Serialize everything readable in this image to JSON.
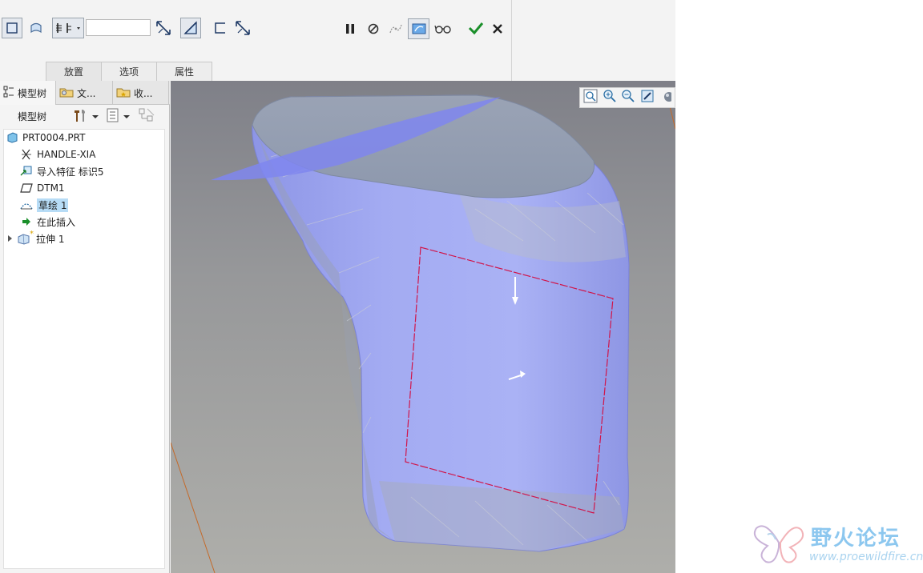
{
  "dashboard": {
    "depth_value": "",
    "tabs": [
      {
        "label": "放置"
      },
      {
        "label": "选项"
      },
      {
        "label": "属性"
      }
    ],
    "icons": {
      "solid": "solid-extrude-icon",
      "surface": "surface-extrude-icon",
      "depth_options": "depth-options-icon",
      "flip_depth": "flip-depth-icon",
      "remove_material": "remove-material-icon",
      "thicken": "thicken-sketch-icon",
      "flip_thicken": "flip-thicken-icon",
      "pause": "pause-icon",
      "no_preview": "no-preview-icon",
      "verify": "verify-icon",
      "preview": "preview-icon",
      "glasses": "glasses-icon",
      "ok": "checkmark-icon",
      "cancel": "close-icon"
    },
    "colors": {
      "ok": "#1a8f2a",
      "cancel": "#222222"
    }
  },
  "left_panel": {
    "tabs": [
      {
        "label": "模型树"
      },
      {
        "label": "文..."
      },
      {
        "label": "收..."
      }
    ],
    "toolbar_label": "模型树",
    "tree": [
      {
        "label": "PRT0004.PRT",
        "icon": "part-icon"
      },
      {
        "label": "HANDLE-XIA",
        "icon": "csys-icon"
      },
      {
        "label": "导入特征 标识5",
        "icon": "import-feature-icon"
      },
      {
        "label": "DTM1",
        "icon": "datum-plane-icon"
      },
      {
        "label": "草绘 1",
        "icon": "sketch-icon",
        "selected": true
      },
      {
        "label": "在此插入",
        "icon": "insert-here-icon"
      },
      {
        "label": "拉伸 1",
        "icon": "extrude-icon",
        "expandable": true
      }
    ]
  },
  "viewport": {
    "toolbar_icons": [
      "refit-icon",
      "zoom-in-icon",
      "zoom-out-icon",
      "repaint-icon",
      "display-style-icon"
    ],
    "colors": {
      "model": "#9aa2ee",
      "sketch": "#d0154a",
      "datum_plane": "#7f86ee"
    }
  },
  "watermark": {
    "title": "野火论坛",
    "url": "www.proewildfire.cn"
  }
}
